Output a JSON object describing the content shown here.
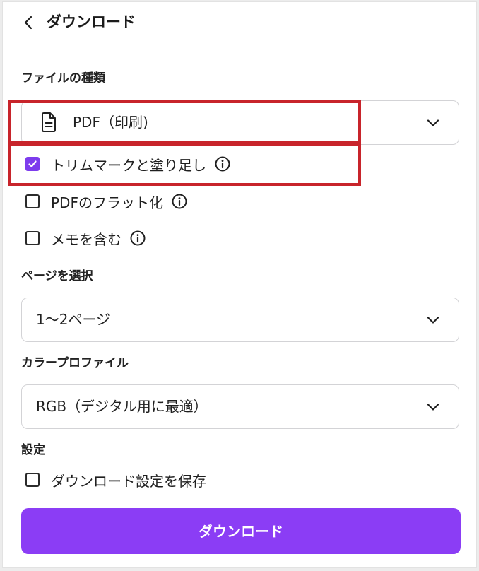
{
  "header": {
    "title": "ダウンロード",
    "back_icon": "chevron-left-icon"
  },
  "file_type": {
    "label": "ファイルの種類",
    "selected": "PDF（印刷)",
    "icon": "document-icon"
  },
  "options": [
    {
      "label": "トリムマークと塗り足し",
      "checked": true,
      "info_icon": "info-icon"
    },
    {
      "label": "PDFのフラット化",
      "checked": false,
      "info_icon": "info-icon"
    },
    {
      "label": "メモを含む",
      "checked": false,
      "info_icon": "info-icon"
    }
  ],
  "pages": {
    "label": "ページを選択",
    "selected": "1〜2ページ"
  },
  "color_profile": {
    "label": "カラープロファイル",
    "selected": "RGB（デジタル用に最適）"
  },
  "settings": {
    "label": "設定",
    "save_label": "ダウンロード設定を保存",
    "save_checked": false
  },
  "download_button": {
    "label": "ダウンロード"
  },
  "colors": {
    "accent": "#8b3df5",
    "checkbox_checked": "#7d3ced",
    "highlight": "#c8242b"
  }
}
